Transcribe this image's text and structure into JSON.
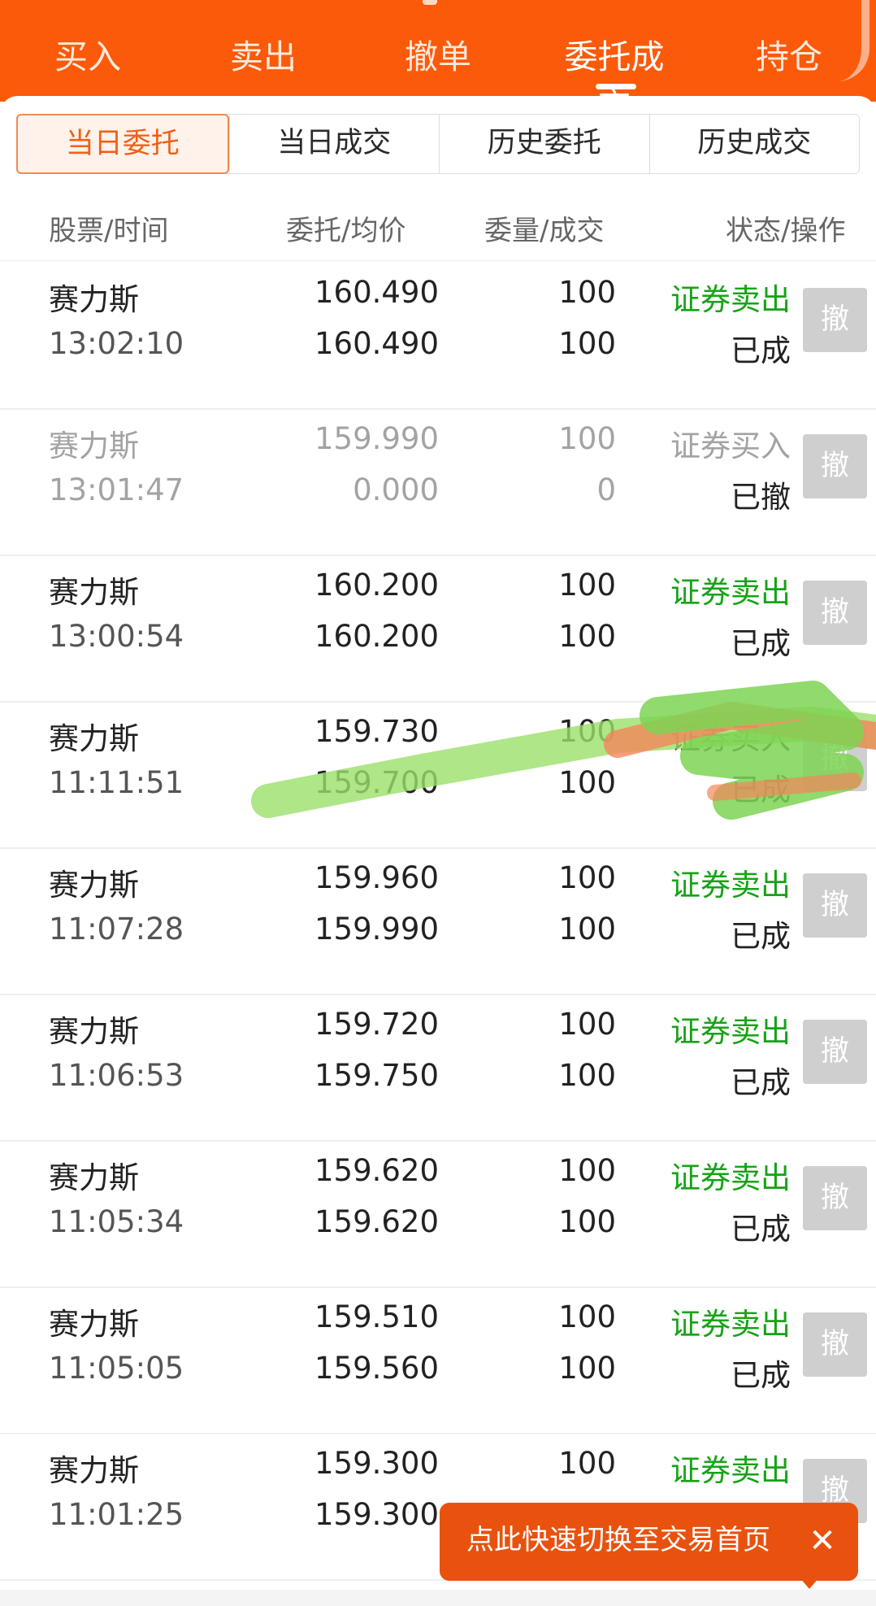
{
  "top_tabs": [
    {
      "label": "买入",
      "active": false
    },
    {
      "label": "卖出",
      "active": false
    },
    {
      "label": "撤单",
      "active": false
    },
    {
      "label": "委托成交",
      "active": true
    },
    {
      "label": "持仓",
      "active": false
    }
  ],
  "segments": [
    {
      "label": "当日委托",
      "active": true
    },
    {
      "label": "当日成交",
      "active": false
    },
    {
      "label": "历史委托",
      "active": false
    },
    {
      "label": "历史成交",
      "active": false
    }
  ],
  "columns": {
    "stock_time": "股票/时间",
    "price_avg": "委托/均价",
    "qty_fill": "委量/成交",
    "status_action": "状态/操作"
  },
  "cancel_label": "撤",
  "orders": [
    {
      "name": "赛力斯",
      "time": "13:02:10",
      "price": "160.490",
      "avg": "160.490",
      "qty": "100",
      "filled": "100",
      "status": "证券卖出",
      "result": "已成"
    },
    {
      "name": "赛力斯",
      "time": "13:01:47",
      "price": "159.990",
      "avg": "0.000",
      "qty": "100",
      "filled": "0",
      "status": "证券买入",
      "result": "已撤"
    },
    {
      "name": "赛力斯",
      "time": "13:00:54",
      "price": "160.200",
      "avg": "160.200",
      "qty": "100",
      "filled": "100",
      "status": "证券卖出",
      "result": "已成"
    },
    {
      "name": "赛力斯",
      "time": "11:11:51",
      "price": "159.730",
      "avg": "159.700",
      "qty": "100",
      "filled": "100",
      "status": "证券买入",
      "result": "已成"
    },
    {
      "name": "赛力斯",
      "time": "11:07:28",
      "price": "159.960",
      "avg": "159.990",
      "qty": "100",
      "filled": "100",
      "status": "证券卖出",
      "result": "已成"
    },
    {
      "name": "赛力斯",
      "time": "11:06:53",
      "price": "159.720",
      "avg": "159.750",
      "qty": "100",
      "filled": "100",
      "status": "证券卖出",
      "result": "已成"
    },
    {
      "name": "赛力斯",
      "time": "11:05:34",
      "price": "159.620",
      "avg": "159.620",
      "qty": "100",
      "filled": "100",
      "status": "证券卖出",
      "result": "已成"
    },
    {
      "name": "赛力斯",
      "time": "11:05:05",
      "price": "159.510",
      "avg": "159.560",
      "qty": "100",
      "filled": "100",
      "status": "证券卖出",
      "result": "已成"
    },
    {
      "name": "赛力斯",
      "time": "11:01:25",
      "price": "159.300",
      "avg": "159.300",
      "qty": "100",
      "filled": "",
      "status": "证券卖出",
      "result": ""
    }
  ],
  "toast": {
    "message": "点此快速切换至交易首页",
    "close_icon": "close-icon"
  },
  "colors": {
    "brand": "#fa5a0a",
    "sell": "#16a316",
    "toast": "#e8520e"
  }
}
